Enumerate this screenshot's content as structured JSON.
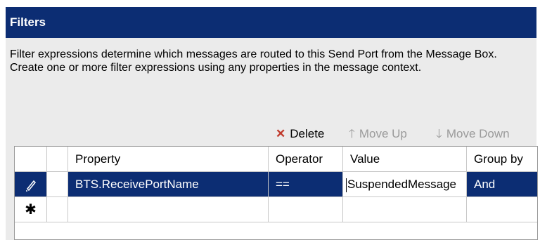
{
  "header": {
    "title": "Filters"
  },
  "description": "Filter expressions determine which messages are routed to this Send Port from the Message Box. Create one or more filter expressions using any properties in the message context.",
  "toolbar": {
    "delete_label": "Delete",
    "move_up_label": "Move Up",
    "move_down_label": "Move Down"
  },
  "grid": {
    "columns": [
      "Property",
      "Operator",
      "Value",
      "Group by"
    ],
    "rows": [
      {
        "property": "BTS.ReceivePortName",
        "operator": "==",
        "value": "SuspendedMessage",
        "group_by": "And"
      }
    ],
    "new_row_glyph": "✱"
  },
  "colors": {
    "title_bar": "#0c2d73",
    "selection": "#0c2d73",
    "delete_icon": "#c0392b"
  }
}
